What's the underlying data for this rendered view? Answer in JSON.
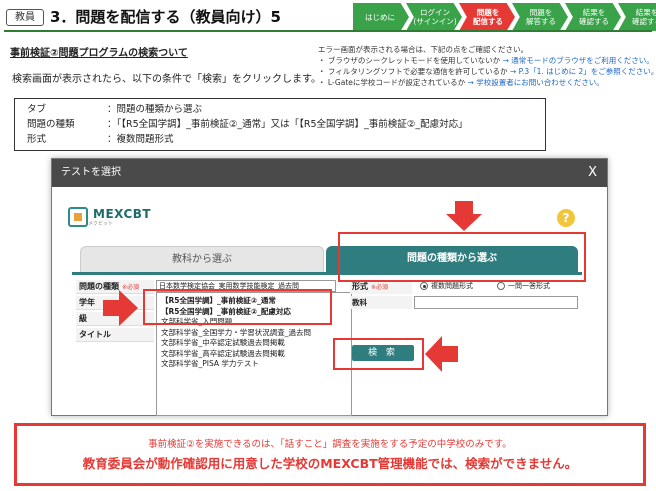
{
  "header": {
    "badge": "教員",
    "title": "3．問題を配信する（教員向け）5",
    "steps": [
      {
        "l1": "はじめに",
        "l2": ""
      },
      {
        "l1": "ログイン",
        "l2": "(サインイン)"
      },
      {
        "l1": "問題を",
        "l2": "配信する"
      },
      {
        "l1": "問題を",
        "l2": "解答する"
      },
      {
        "l1": "結果を",
        "l2": "確認する"
      },
      {
        "l1": "結果を",
        "l2": "確認する"
      }
    ],
    "active_step": 2
  },
  "intro": {
    "title": "事前検証②問題プログラムの検索ついて",
    "description": "検索画面が表示されたら、以下の条件で「検索」をクリックします。"
  },
  "errors": {
    "heading": "エラー画面が表示される場合は、下記の点をご確認ください。",
    "r1_text": "・ ブラウザのシークレットモードを使用していないか",
    "r1_link": "→ 通常モードのブラウザをご利用ください。",
    "r2_text": "・ フィルタリングソフトで必要な通信を許可しているか",
    "r2_link": "→ P.3「1. はじめに 2」をご参照ください。",
    "r3_text": "・ L-Gateに学校コードが設定されているか",
    "r3_link": "→ 学校設置者にお問い合わせください。"
  },
  "conditions": {
    "r1_key": "タブ",
    "r1_val": "：問題の種類から選ぶ",
    "r2_key": "問題の種類",
    "r2_val": "：「【R5全国学調】_事前検証②_通常」又は「【R5全国学調】_事前検証②_配慮対応」",
    "r3_key": "形式",
    "r3_val": "：複数問題形式"
  },
  "dialog": {
    "title": "テストを選択",
    "close": "X",
    "logo": "MEXCBT",
    "logo_sub": "メクビット",
    "help": "?",
    "tab_inactive": "教科から選ぶ",
    "tab_active": "問題の種類から選ぶ",
    "labels": {
      "type": "問題の種類",
      "required": "※必須",
      "grade": "学年",
      "level": "級",
      "title": "タイトル",
      "format": "形式",
      "format_required": "※必須",
      "subject": "教科"
    },
    "type_value": "日本数学検定協会_実用数学技能検定_過去問",
    "dropdown": [
      "【R5全国学調】_事前検証②_通常",
      "【R5全国学調】_事前検証②_配慮対応",
      "文部科学省_入門問題",
      "文部科学省_全国学力・学習状況調査_過去問",
      "文部科学省_中卒認定試験過去問掲載",
      "文部科学省_高卒認定試験過去問掲載",
      "文部科学省_PISA 学力テスト"
    ],
    "radio_multi": "複数問題形式",
    "radio_single": "一問一答形式",
    "search": "検 索"
  },
  "notice": {
    "line1": "事前検証②を実施できるのは、「話すこと」調査を実施をする予定の中学校のみです。",
    "line2": "教育委員会が動作確認用に用意した学校のMEXCBT管理機能では、検索ができません。"
  },
  "colors": {
    "accent_green": "#3aa34a",
    "teal": "#2f7d7f",
    "alert_red": "#e53935"
  }
}
